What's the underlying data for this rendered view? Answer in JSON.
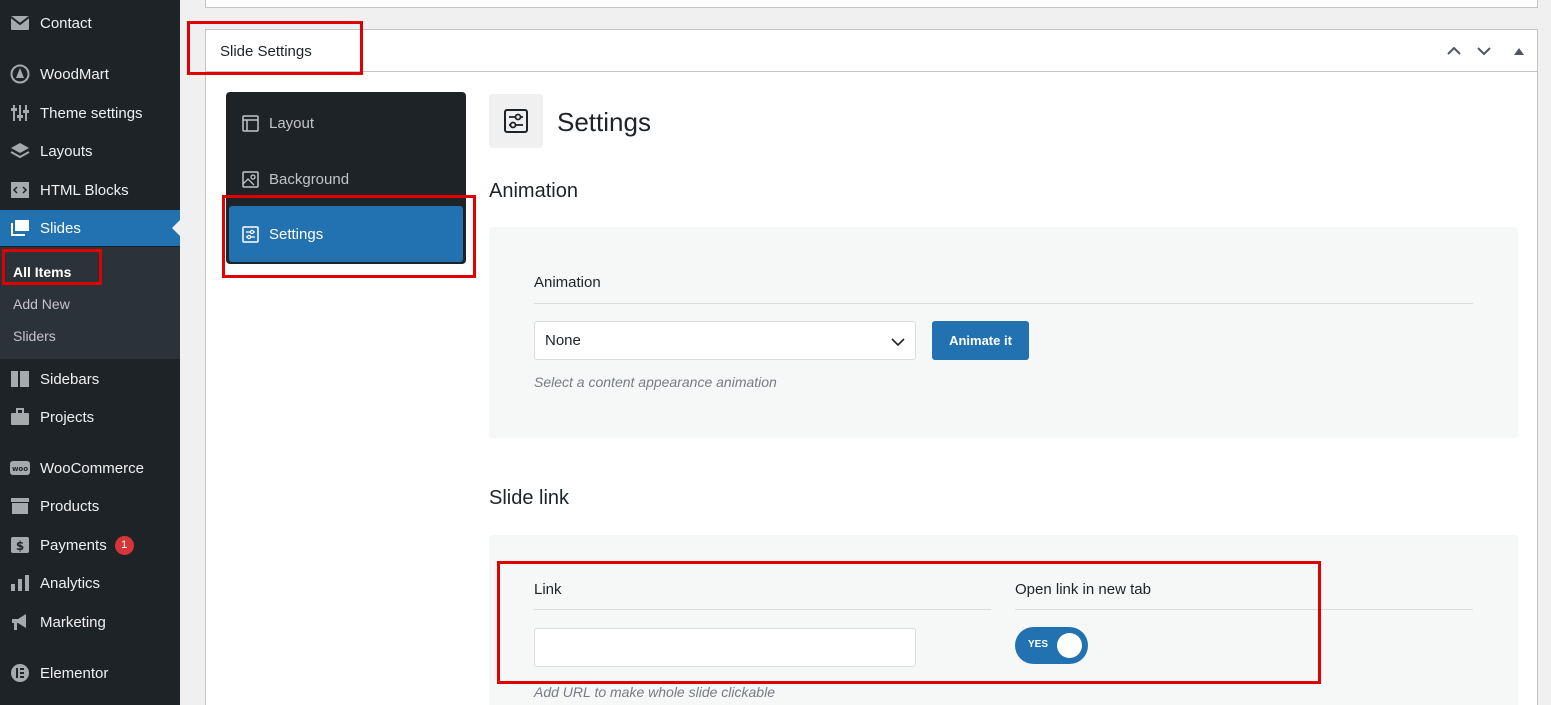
{
  "sidebar": {
    "items": [
      {
        "label": "Contact",
        "icon": "envelope-icon"
      },
      {
        "label": "WoodMart",
        "icon": "woodmart-icon"
      },
      {
        "label": "Theme settings",
        "icon": "sliders-icon"
      },
      {
        "label": "Layouts",
        "icon": "layers-icon"
      },
      {
        "label": "HTML Blocks",
        "icon": "code-block-icon"
      },
      {
        "label": "Slides",
        "icon": "slides-icon"
      },
      {
        "label": "Sidebars",
        "icon": "sidebar-icon"
      },
      {
        "label": "Projects",
        "icon": "briefcase-icon"
      },
      {
        "label": "WooCommerce",
        "icon": "woo-icon"
      },
      {
        "label": "Products",
        "icon": "archive-icon"
      },
      {
        "label": "Payments",
        "icon": "dollar-icon",
        "badge": "1"
      },
      {
        "label": "Analytics",
        "icon": "chart-icon"
      },
      {
        "label": "Marketing",
        "icon": "megaphone-icon"
      },
      {
        "label": "Elementor",
        "icon": "elementor-icon"
      }
    ],
    "submenu": [
      "All Items",
      "Add New",
      "Sliders"
    ]
  },
  "metabox": {
    "title": "Slide Settings"
  },
  "tabs": [
    "Layout",
    "Background",
    "Settings"
  ],
  "settings": {
    "heading": "Settings",
    "animation_section": "Animation",
    "animation_label": "Animation",
    "animation_value": "None",
    "animate_button": "Animate it",
    "animation_hint": "Select a content appearance animation",
    "link_section": "Slide link",
    "link_label": "Link",
    "link_value": "",
    "link_hint": "Add URL to make whole slide clickable",
    "new_tab_label": "Open link in new tab",
    "toggle_text": "YES"
  },
  "colors": {
    "sidebar_bg": "#1d2327",
    "accent": "#2271b1",
    "highlight": "#e00000",
    "badge": "#d63638"
  }
}
